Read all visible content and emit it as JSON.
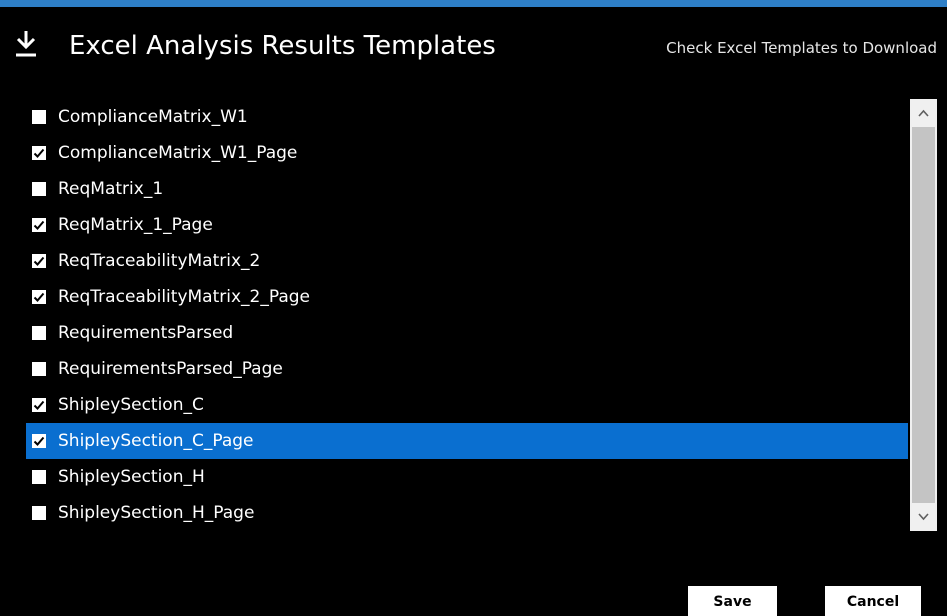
{
  "header": {
    "icon": "download-icon",
    "title": "Excel Analysis Results Templates",
    "hint": "Check Excel Templates to Download",
    "accent_color": "#2e7fc7"
  },
  "templates": [
    {
      "label": "ComplianceMatrix_W1",
      "checked": false,
      "selected": false
    },
    {
      "label": "ComplianceMatrix_W1_Page",
      "checked": true,
      "selected": false
    },
    {
      "label": "ReqMatrix_1",
      "checked": false,
      "selected": false
    },
    {
      "label": "ReqMatrix_1_Page",
      "checked": true,
      "selected": false
    },
    {
      "label": "ReqTraceabilityMatrix_2",
      "checked": true,
      "selected": false
    },
    {
      "label": "ReqTraceabilityMatrix_2_Page",
      "checked": true,
      "selected": false
    },
    {
      "label": "RequirementsParsed",
      "checked": false,
      "selected": false
    },
    {
      "label": "RequirementsParsed_Page",
      "checked": false,
      "selected": false
    },
    {
      "label": "ShipleySection_C",
      "checked": true,
      "selected": false
    },
    {
      "label": "ShipleySection_C_Page",
      "checked": true,
      "selected": true
    },
    {
      "label": "ShipleySection_H",
      "checked": false,
      "selected": false
    },
    {
      "label": "ShipleySection_H_Page",
      "checked": false,
      "selected": false
    }
  ],
  "selection_color": "#0a6fd0",
  "buttons": {
    "save": "Save",
    "cancel": "Cancel"
  }
}
